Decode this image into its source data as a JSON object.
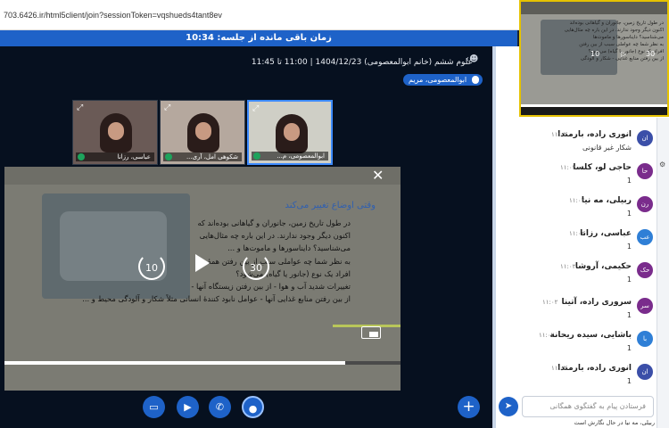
{
  "browser": {
    "url": "703.6426.ir/html5client/join?sessionToken=vqshueds4tant8ev"
  },
  "session": {
    "time_remaining": "زمان باقی مانده از جلسه: 10:34",
    "meeting_info": "علوم ششم (خانم ابوالمعصومی) 1404/12/23 | 11:00 تا 11:45",
    "presenter": "ابوالمعصومی، مریم"
  },
  "webcams": [
    {
      "name": "عباسی، رزانا"
    },
    {
      "name": "شکوهی امل، آری..."
    },
    {
      "name": "ابوالمعصومی، م..."
    }
  ],
  "slide": {
    "title": "وقتی اوضاع تغییر می‌کند",
    "lines": [
      "در طول تاریخ زمین، جانوران و گیاهانی بوده‌اند که",
      "اکنون دیگر وجود ندارند. در این باره چه مثال‌هایی",
      "می‌شناسید؟ دایناسورها و ماموت‌ها و ...",
      "به نظر شما چه عواملی سبب از بین رفتن همهٔ",
      "افراد یک نوع (جانور یا گیاه) می‌شود؟",
      "تغییرات شدید آب و هوا - از بین رفتن زیستگاه آنها -",
      "از بین رفتن منابع غذایی آنها - عوامل نابود کنندهٔ انسانی مثلاً شکار و آلودگی محیط و ..."
    ]
  },
  "video": {
    "rewind_label": "10",
    "forward_label": "30",
    "progress": 0.86
  },
  "chat": {
    "messages": [
      {
        "initials": "ان",
        "name": "انوری راده، بارمندا",
        "time": "۱۱:۰۲",
        "body": "شکار غیر قانونی",
        "color": "#3b4fa8"
      },
      {
        "initials": "حا",
        "name": "حاجی لو، کلسا",
        "time": "۱۱:۰۲",
        "body": "1",
        "color": "#7a2c8c"
      },
      {
        "initials": "رن",
        "name": "ربیلی، مه نیا",
        "time": "۱۱:۰۲",
        "body": "1",
        "color": "#7a2c8c"
      },
      {
        "initials": "عب",
        "name": "عباسی، رزانا",
        "time": "۱۱:۰۲",
        "body": "1",
        "color": "#2f7fd6"
      },
      {
        "initials": "حک",
        "name": "حکیمی، آروشا",
        "time": "۱۱:۰۲",
        "body": "1",
        "color": "#7a2c8c"
      },
      {
        "initials": "سر",
        "name": "سروری راده، آتینا",
        "time": "۱۱:۰۲",
        "body": "1",
        "color": "#7a2c8c"
      },
      {
        "initials": "با",
        "name": "باشایی، سیده ریحانه",
        "time": "۱۱:۰۲",
        "body": "1",
        "color": "#2f7fd6"
      },
      {
        "initials": "ان",
        "name": "انوری راده، بارمندا",
        "time": "۱۱:۰۲",
        "body": "1",
        "color": "#3b4fa8"
      }
    ],
    "input_placeholder": "فرستادن پیام به گفتگوی همگانی",
    "typing": "ربیلی، مه نیا در حال نگارش است"
  },
  "floating_preview": {
    "lines": [
      "در طول تاریخ زمین، جانوران و گیاهانی بوده‌اند",
      "اکنون دیگر وجود ندارند. در این باره چه مثال‌هایی",
      "می‌شناسید؟ دایناسورها و ماموت‌ها",
      "به نظر شما چه عواملی سبب از بین رفتن",
      "افراد یک نوع (جانور یا گیاه) می‌شود؟",
      "از بین رفتن منابع غذایی - شکار و آلودگی"
    ]
  }
}
